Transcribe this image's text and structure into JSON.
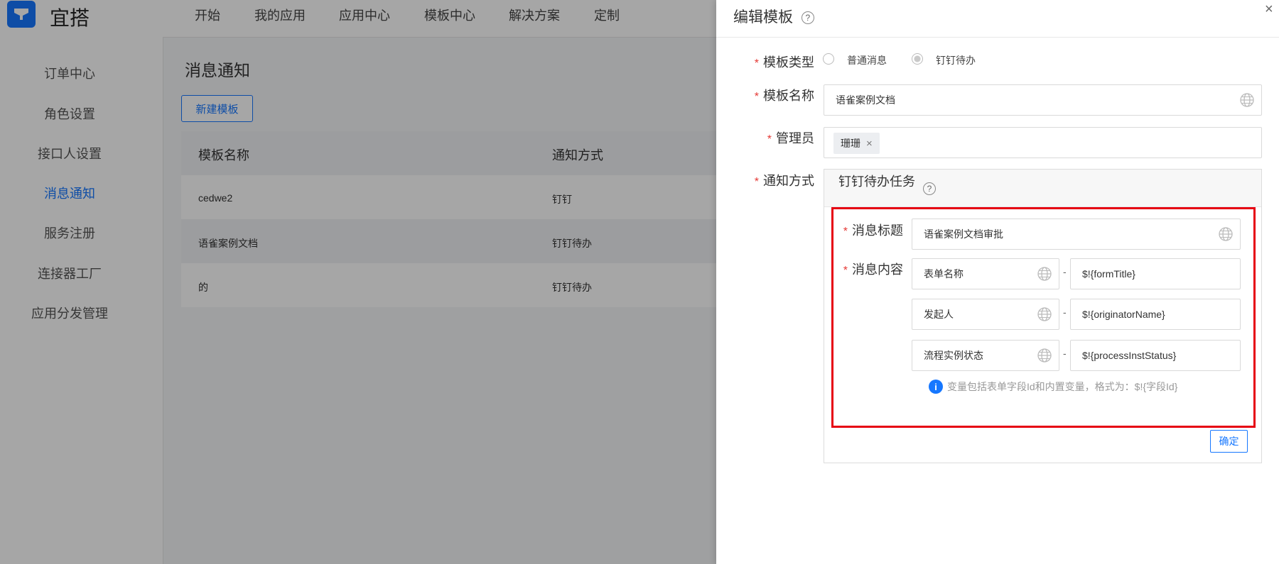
{
  "app": {
    "brand": "宜搭"
  },
  "nav": [
    "开始",
    "我的应用",
    "应用中心",
    "模板中心",
    "解决方案",
    "定制"
  ],
  "sidebar": {
    "items": [
      "订单中心",
      "角色设置",
      "接口人设置",
      "消息通知",
      "服务注册",
      "连接器工厂",
      "应用分发管理"
    ],
    "active": "消息通知"
  },
  "main": {
    "title": "消息通知",
    "new_button": "新建模板",
    "columns": [
      "模板名称",
      "通知方式"
    ],
    "rows": [
      {
        "name": "cedwe2",
        "method": "钉钉"
      },
      {
        "name": "语雀案例文档",
        "method": "钉钉待办"
      },
      {
        "name": "的",
        "method": "钉钉待办"
      }
    ]
  },
  "drawer": {
    "title": "编辑模板",
    "help": "?",
    "close": "×",
    "template_type": {
      "label": "模板类型",
      "options": [
        "普通消息",
        "钉钉待办"
      ],
      "selected": "钉钉待办"
    },
    "template_name": {
      "label": "模板名称",
      "value": "语雀案例文档"
    },
    "admin": {
      "label": "管理员",
      "tag": "珊珊",
      "tag_remove": "×"
    },
    "notify_method": {
      "label": "通知方式",
      "panel_title": "钉钉待办任务",
      "msg_title": {
        "label": "消息标题",
        "value": "语雀案例文档审批"
      },
      "msg_content": {
        "label": "消息内容",
        "separator": "-",
        "pairs": [
          {
            "key": "表单名称",
            "value": "$!{formTitle}"
          },
          {
            "key": "发起人",
            "value": "$!{originatorName}"
          },
          {
            "key": "流程实例状态",
            "value": "$!{processInstStatus}"
          }
        ]
      },
      "hint": "变量包括表单字段Id和内置变量，格式为：$!{字段Id}",
      "info_icon": "i",
      "confirm": "确定"
    }
  },
  "colors": {
    "accent": "#1677ff",
    "required": "#e53935",
    "highlight_box": "#e60012"
  }
}
